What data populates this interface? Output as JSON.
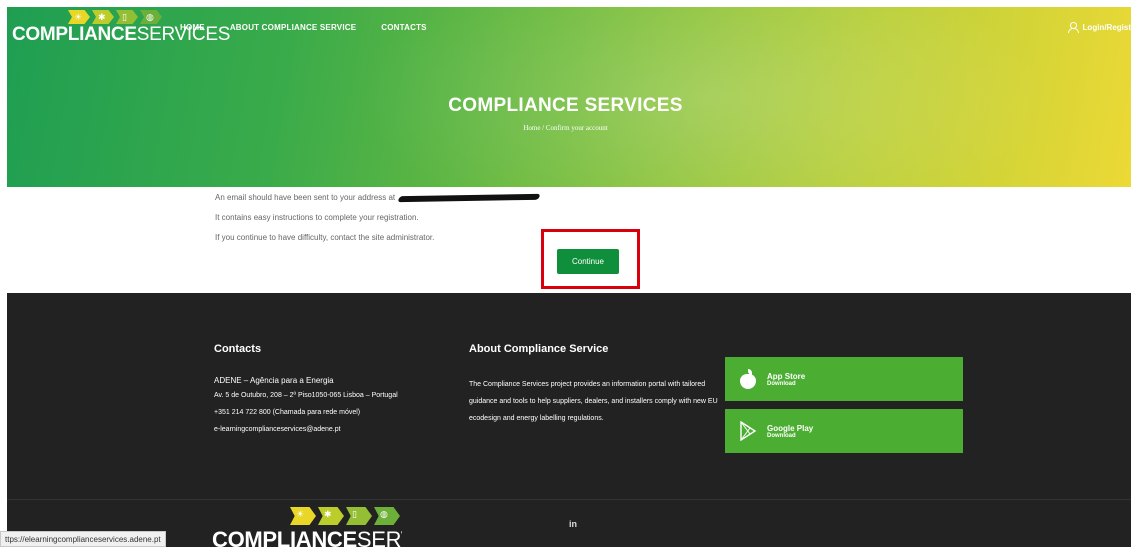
{
  "header": {
    "logo": {
      "bold": "COMPLIANCE",
      "light": "SERVICES"
    },
    "nav": [
      "HOME",
      "ABOUT COMPLIANCE SERVICE",
      "CONTACTS"
    ],
    "login_label": "Login/Regist"
  },
  "hero": {
    "title": "COMPLIANCE SERVICES",
    "breadcrumb": "Home  /  Confirm your account"
  },
  "main": {
    "line1": "An email should have been sent to your address at",
    "line2": "It contains easy instructions to complete your registration.",
    "line3": "If you continue to have difficulty, contact the site administrator.",
    "continue_label": "Continue"
  },
  "footer": {
    "contacts_heading": "Contacts",
    "org": "ADENE – Agência para a Energia",
    "address": "Av. 5 de Outubro, 208 – 2º Piso1050-065 Lisboa – Portugal",
    "phone": "+351 214 722 800 (Chamada para rede móvel)",
    "email": "e-learningcomplianceservices@adene.pt",
    "about_heading": "About Compliance Service",
    "about_text": "The Compliance Services project provides an information portal with tailored guidance and tools to help suppliers, dealers, and installers comply with new EU ecodesign and energy labelling regulations.",
    "app_store": {
      "name": "App Store",
      "sub": "Download"
    },
    "google_play": {
      "name": "Google Play",
      "sub": "Download"
    },
    "linkedin": "in"
  },
  "status_bar": {
    "url": "ttps://elearningcomplianceservices.adene.pt"
  },
  "colors": {
    "continue_button": "#0f8f3b",
    "highlight_border": "#d9000b",
    "store_button": "#4bae32",
    "footer_bg": "#222222"
  }
}
